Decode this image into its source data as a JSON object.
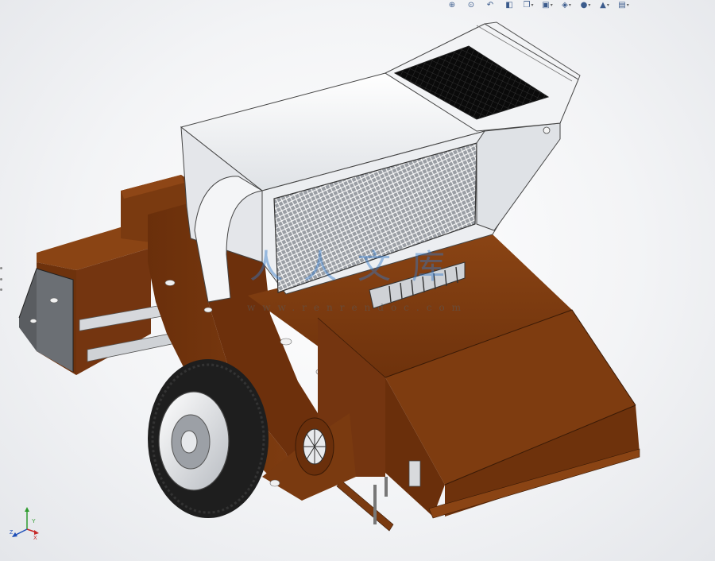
{
  "toolbar": {
    "buttons": [
      {
        "name": "zoom-to-fit",
        "icon": "zoom-fit-icon",
        "glyph": "⊕"
      },
      {
        "name": "zoom-to-area",
        "icon": "zoom-area-icon",
        "glyph": "⊙"
      },
      {
        "name": "previous-view",
        "icon": "previous-view-icon",
        "glyph": "↶"
      },
      {
        "name": "section-view",
        "icon": "section-view-icon",
        "glyph": "◧"
      },
      {
        "name": "view-orientation",
        "icon": "view-orientation-icon",
        "glyph": "❐",
        "dropdown": true
      },
      {
        "name": "display-style",
        "icon": "display-style-icon",
        "glyph": "▣",
        "dropdown": true
      },
      {
        "name": "hide-show-items",
        "icon": "hide-show-icon",
        "glyph": "◈",
        "dropdown": true
      },
      {
        "name": "edit-appearance",
        "icon": "appearance-icon",
        "glyph": "●",
        "dropdown": true
      },
      {
        "name": "apply-scene",
        "icon": "scene-icon",
        "glyph": "▲",
        "dropdown": true
      },
      {
        "name": "view-settings",
        "icon": "view-settings-icon",
        "glyph": "▤",
        "dropdown": true
      }
    ]
  },
  "watermark": {
    "chars": "人人文库",
    "url": "www.renrendoc.com"
  },
  "triad": {
    "x": "X",
    "y": "Y",
    "z": "Z"
  },
  "colors": {
    "body": "#7a3a10",
    "hopper": "#e9ebee",
    "screen": "#8e939a",
    "tire": "#1e1e1e"
  }
}
